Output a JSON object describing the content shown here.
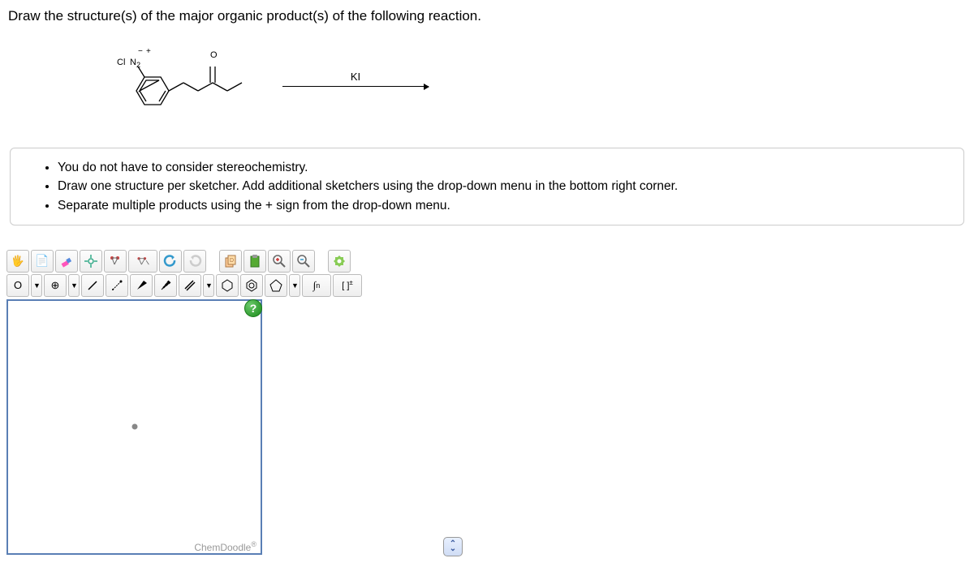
{
  "question": {
    "title": "Draw the structure(s) of the major organic product(s) of the following reaction.",
    "reagent": "KI",
    "mol_labels": {
      "cl": "Cl",
      "n2": "N",
      "n2_sub": "2",
      "minus": "−",
      "plus": "+",
      "o": "O"
    }
  },
  "instructions": [
    "You do not have to consider stereochemistry.",
    "Draw one structure per sketcher. Add additional sketchers using the drop-down menu in the bottom right corner.",
    "Separate multiple products using the + sign from the drop-down menu."
  ],
  "toolbar1": {
    "move": "✋",
    "undo_alt": "📄",
    "eraser": "erase",
    "center": "✥",
    "clean": "clean",
    "marvin": "marvin",
    "undo": "↶",
    "redo": "↷",
    "copy": "📋",
    "paste": "📋",
    "zoom_in": "🔍+",
    "zoom_out": "🔍−",
    "settings": "⚙"
  },
  "toolbar2": {
    "atom": "O",
    "charge": "⊕",
    "single": "/",
    "dotted": "⋰",
    "wedge": "▲",
    "hash": "▼",
    "double": "//",
    "benzene": "⬡",
    "cyclopentane": "⬠",
    "cyclohexane": "⬡",
    "sn": "∫n",
    "bracket": "[ ]±"
  },
  "sketcher": {
    "help": "?",
    "brand": "ChemDoodle",
    "add": "⌃⌄"
  }
}
